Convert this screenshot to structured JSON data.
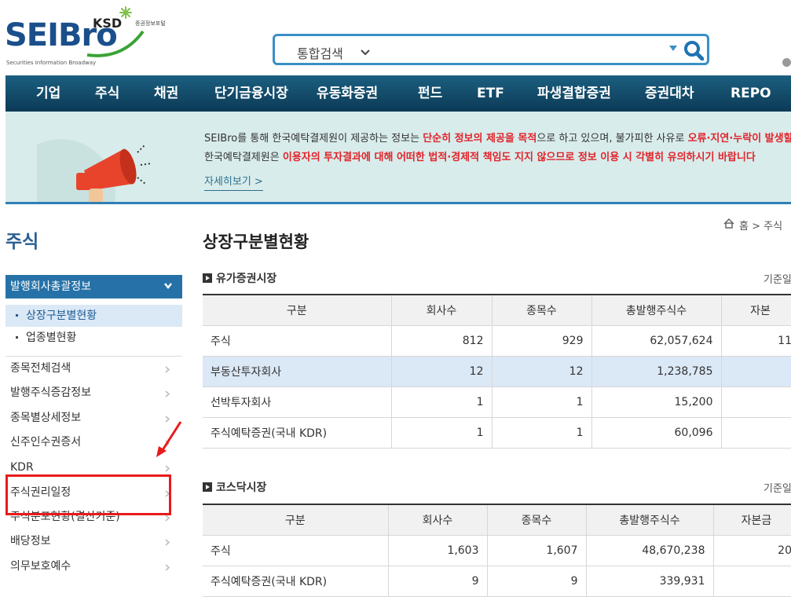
{
  "header": {
    "logo": {
      "brand": "SEIBro",
      "ksd": "KSD",
      "ksd_sub": "증권정보포털",
      "tagline": "Securities Information Broadway"
    },
    "search": {
      "category": "통합검색",
      "icons": [
        "chevron-down-icon",
        "dropdown-arrow-icon",
        "search-icon"
      ]
    }
  },
  "nav": [
    "기업",
    "주식",
    "채권",
    "단기금융시장",
    "유동화증권",
    "펀드",
    "ETF",
    "파생결합증권",
    "증권대차",
    "REPO"
  ],
  "notice": {
    "line1_a": "SEIBro를 통해 한국예탁결제원이 제공하는 정보는 ",
    "line1_red": "단순히 정보의 제공을 목적",
    "line1_b": "으로 하고 있으며, 불가피한 사유로 ",
    "line1_red2": "오류·지연·누락이 발생할",
    "line2_a": "한국예탁결제원은 ",
    "line2_red": "이용자의 투자결과에 대해 어떠한 법적·경제적 책임도 지지 않으므로 정보 이용 시 각별히 유의하시기 바랍니다",
    "more": "자세히보기  >"
  },
  "sidebar": {
    "title": "주식",
    "section": "발행회사총괄정보",
    "sub_items": [
      {
        "label": "상장구분별현황",
        "active": true
      },
      {
        "label": "업종별현황",
        "active": false
      }
    ],
    "menu": [
      "종목전체검색",
      "발행주식증감정보",
      "종목별상세정보",
      "신주인수권증서",
      "KDR",
      "주식권리일정",
      "주식분포현황(결산기준)",
      "배당정보",
      "의무보호예수"
    ]
  },
  "main": {
    "title": "상장구분별현황",
    "breadcrumb": "홈 > 주식",
    "sections": [
      {
        "title": "유가증권시장",
        "base_date": "기준일",
        "headers": [
          "구분",
          "회사수",
          "종목수",
          "총발행주식수",
          "자본"
        ],
        "rows": [
          [
            "주식",
            "812",
            "929",
            "62,057,624",
            "11"
          ],
          [
            "부동산투자회사",
            "12",
            "12",
            "1,238,785",
            ""
          ],
          [
            "선박투자회사",
            "1",
            "1",
            "15,200",
            ""
          ],
          [
            "주식예탁증권(국내 KDR)",
            "1",
            "1",
            "60,096",
            ""
          ]
        ],
        "highlight_row": 1
      },
      {
        "title": "코스닥시장",
        "base_date": "기준일",
        "headers": [
          "구분",
          "회사수",
          "종목수",
          "총발행주식수",
          "자본금"
        ],
        "rows": [
          [
            "주식",
            "1,603",
            "1,607",
            "48,670,238",
            "20"
          ],
          [
            "주식예탁증권(국내 KDR)",
            "9",
            "9",
            "339,931",
            ""
          ]
        ]
      }
    ]
  },
  "colors": {
    "nav": "#0c3a56",
    "accent_blue": "#2672a8",
    "notice_bg": "#d8eceb",
    "alert_red": "#e2232a",
    "annotation_red": "#e81b1b"
  }
}
